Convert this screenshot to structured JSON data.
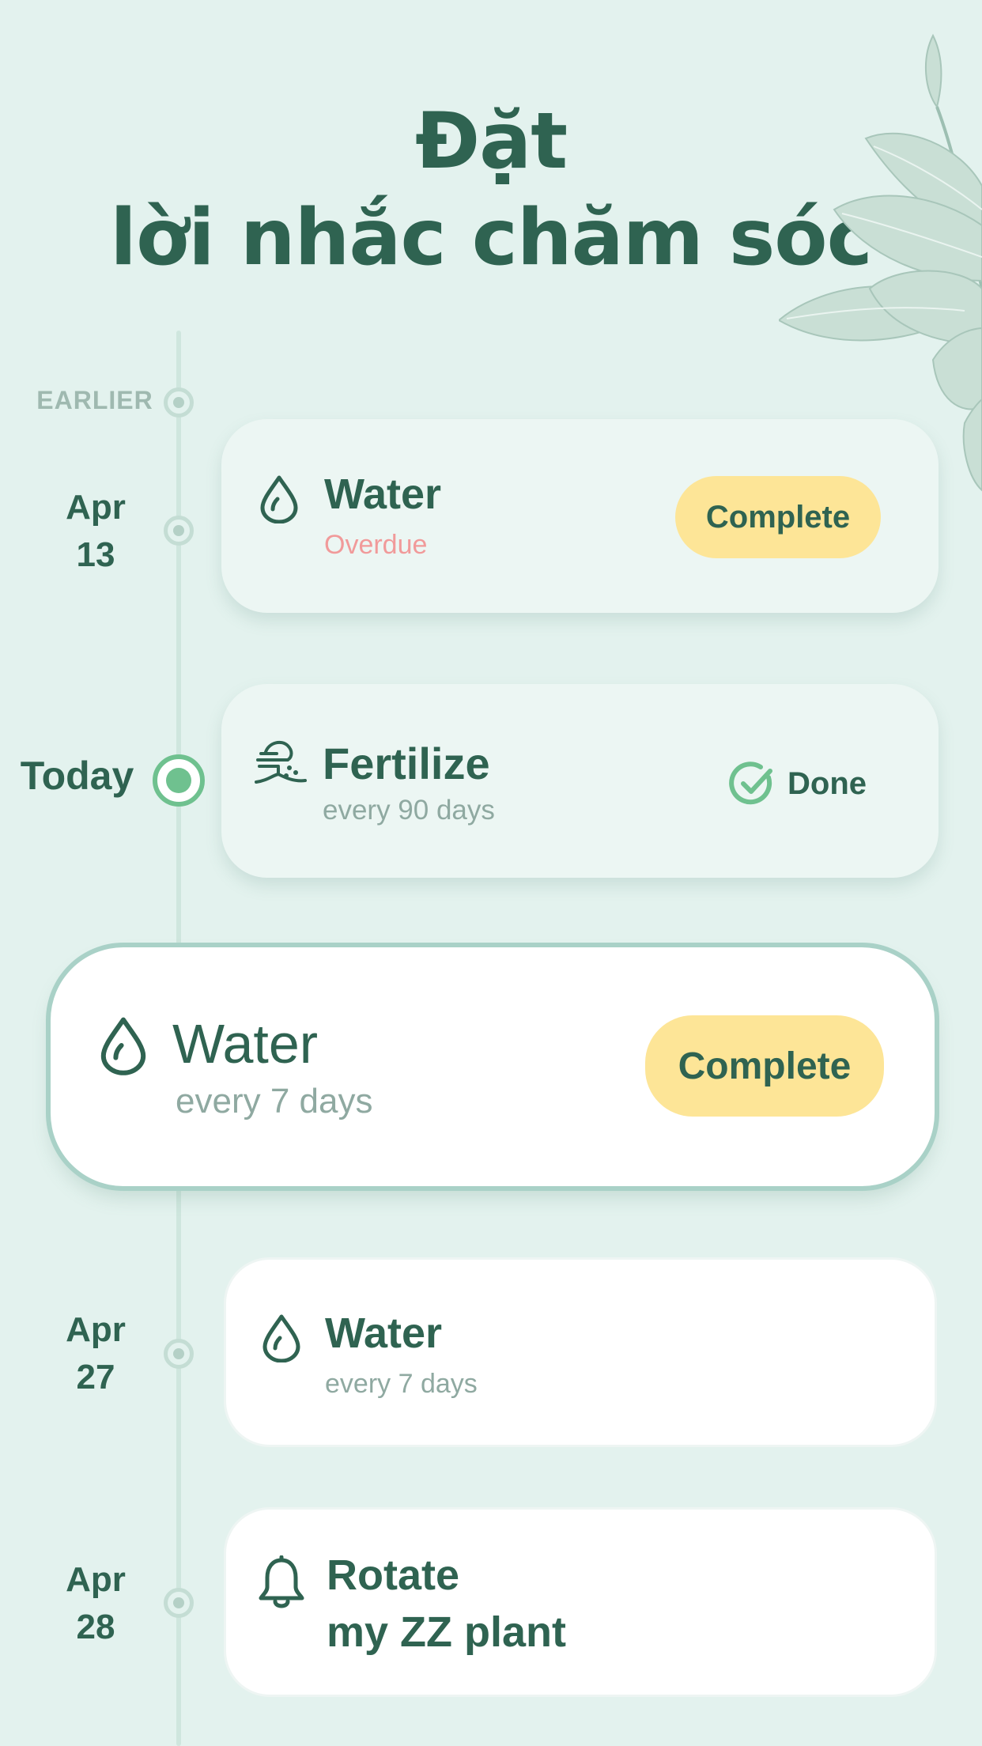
{
  "header": {
    "title_line1": "Đặt",
    "title_line2": "lời nhắc chăm sóc"
  },
  "timeline": {
    "earlier_label": "EARLIER",
    "today_label": "Today"
  },
  "reminders": [
    {
      "date_month": "Apr",
      "date_day": "13",
      "icon": "water-drop-icon",
      "title": "Water",
      "subtitle": "Overdue",
      "action": "Complete"
    },
    {
      "date_label": "Today",
      "icon": "fertilize-icon",
      "title": "Fertilize",
      "subtitle": "every 90 days",
      "action": "Done",
      "status_icon": "check-circle-icon"
    },
    {
      "icon": "water-drop-icon",
      "title": "Water",
      "subtitle": "every 7 days",
      "action": "Complete"
    },
    {
      "date_month": "Apr",
      "date_day": "27",
      "icon": "water-drop-icon",
      "title": "Water",
      "subtitle": "every 7 days"
    },
    {
      "date_month": "Apr",
      "date_day": "28",
      "icon": "bell-icon",
      "title_line1": "Rotate",
      "title_line2": "my ZZ plant"
    }
  ],
  "colors": {
    "background": "#e3f2ee",
    "text_primary": "#2f6351",
    "accent_yellow": "#fde597",
    "accent_green": "#6fc18f",
    "overdue_red": "#f19a9a"
  }
}
